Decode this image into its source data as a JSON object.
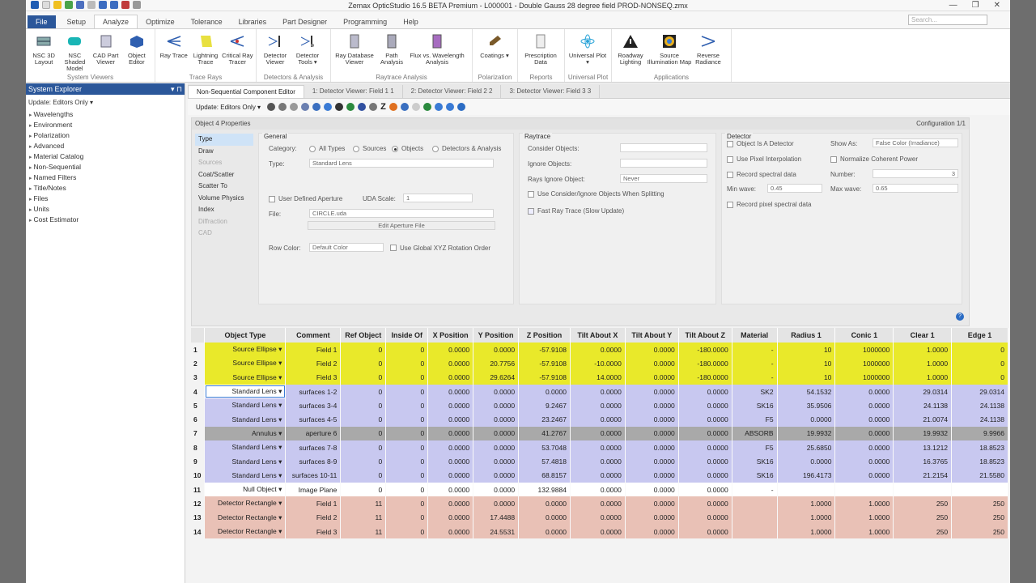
{
  "app": {
    "title": "Zemax OpticStudio 16.5  BETA  Premium  -  L000001  -  Double Gauss 28 degree field PROD-NONSEQ.zmx",
    "search_placeholder": "Search..."
  },
  "menu": [
    "File",
    "Setup",
    "Analyze",
    "Optimize",
    "Tolerance",
    "Libraries",
    "Part Designer",
    "Programming",
    "Help"
  ],
  "ribbon": {
    "groups": [
      {
        "label": "System Viewers",
        "buttons": [
          "NSC 3D Layout",
          "NSC Shaded Model",
          "CAD Part Viewer",
          "Object Editor"
        ]
      },
      {
        "label": "Trace Rays",
        "buttons": [
          "Ray Trace",
          "Lightning Trace",
          "Critical Ray Tracer"
        ]
      },
      {
        "label": "Detectors & Analysis",
        "buttons": [
          "Detector Viewer",
          "Detector Tools ▾"
        ]
      },
      {
        "label": "Raytrace Analysis",
        "buttons": [
          "Ray Database Viewer",
          "Path Analysis",
          "Flux vs. Wavelength Analysis"
        ]
      },
      {
        "label": "Polarization",
        "buttons": [
          "Coatings ▾"
        ]
      },
      {
        "label": "Reports",
        "buttons": [
          "Prescription Data"
        ]
      },
      {
        "label": "Universal Plot",
        "buttons": [
          "Universal Plot ▾"
        ]
      },
      {
        "label": "Applications",
        "buttons": [
          "Roadway Lighting",
          "Source Illumination Map",
          "Reverse Radiance"
        ]
      }
    ]
  },
  "system_explorer": {
    "title": "System Explorer",
    "update": "Update: Editors Only ▾",
    "items": [
      "Wavelengths",
      "Environment",
      "Polarization",
      "Advanced",
      "Material Catalog",
      "Non-Sequential",
      "Named Filters",
      "Title/Notes",
      "Files",
      "Units",
      "Cost Estimator"
    ]
  },
  "doc_tabs": [
    "Non-Sequential Component Editor",
    "1: Detector Viewer: Field 1 1",
    "2: Detector Viewer: Field 2 2",
    "3: Detector Viewer: Field 3 3"
  ],
  "toolbar": {
    "update": "Update: Editors Only ▾"
  },
  "props": {
    "header": "Object 4 Properties",
    "configuration": "Configuration 1/1",
    "nav": [
      "Type",
      "Draw",
      "Sources",
      "Coat/Scatter",
      "Scatter To",
      "Volume Physics",
      "Index",
      "Diffraction",
      "CAD"
    ],
    "general": {
      "title": "General",
      "category_label": "Category:",
      "category_options": [
        "All Types",
        "Sources",
        "Objects",
        "Detectors & Analysis"
      ],
      "type_label": "Type:",
      "type_value": "Standard Lens",
      "user_aperture": "User Defined Aperture",
      "uda_scale_label": "UDA Scale:",
      "uda_scale_value": "1",
      "file_label": "File:",
      "file_value": "CIRCLE.uda",
      "edit_aperture": "Edit Aperture File",
      "row_color_label": "Row Color:",
      "row_color_value": "Default Color",
      "global_xyz": "Use Global XYZ Rotation Order"
    },
    "raytrace": {
      "title": "Raytrace",
      "consider_label": "Consider Objects:",
      "ignore_label": "Ignore Objects:",
      "rays_ignore_label": "Rays Ignore Object:",
      "rays_ignore_value": "Never",
      "use_consider": "Use Consider/Ignore Objects When Splitting",
      "fast_ray": "Fast Ray Trace (Slow Update)"
    },
    "detector": {
      "title": "Detector",
      "is_detector": "Object Is A Detector",
      "show_as_label": "Show As:",
      "show_as_value": "False Color (Irradiance)",
      "pixel_interp": "Use Pixel Interpolation",
      "normalize": "Normalize Coherent Power",
      "record_spectral": "Record spectral data",
      "number_label": "Number:",
      "number_value": "3",
      "min_wave_label": "Min wave:",
      "min_wave_value": "0.45",
      "max_wave_label": "Max wave:",
      "max_wave_value": "0.65",
      "record_pixel": "Record pixel spectral data"
    }
  },
  "grid": {
    "columns": [
      "",
      "Object Type",
      "Comment",
      "Ref Object",
      "Inside Of",
      "X Position",
      "Y Position",
      "Z Position",
      "Tilt About X",
      "Tilt About Y",
      "Tilt About Z",
      "Material",
      "Radius 1",
      "Conic 1",
      "Clear 1",
      "Edge 1"
    ],
    "rows": [
      {
        "style": "yellow",
        "cells": [
          "1",
          "Source Ellipse ▾",
          "Field 1",
          "0",
          "0",
          "0.0000",
          "0.0000",
          "-57.9108",
          "0.0000",
          "0.0000",
          "-180.0000",
          "-",
          "10",
          "1000000",
          "1.0000",
          "0"
        ]
      },
      {
        "style": "yellow",
        "cells": [
          "2",
          "Source Ellipse ▾",
          "Field 2",
          "0",
          "0",
          "0.0000",
          "20.7756",
          "-57.9108",
          "-10.0000",
          "0.0000",
          "-180.0000",
          "-",
          "10",
          "1000000",
          "1.0000",
          "0"
        ]
      },
      {
        "style": "yellow",
        "cells": [
          "3",
          "Source Ellipse ▾",
          "Field 3",
          "0",
          "0",
          "0.0000",
          "29.6264",
          "-57.9108",
          "14.0000",
          "0.0000",
          "-180.0000",
          "-",
          "10",
          "1000000",
          "1.0000",
          "0"
        ]
      },
      {
        "style": "purple",
        "cells": [
          "4",
          "Standard Lens ▾",
          "surfaces 1-2",
          "0",
          "0",
          "0.0000",
          "0.0000",
          "0.0000",
          "0.0000",
          "0.0000",
          "0.0000",
          "SK2",
          "54.1532",
          "0.0000",
          "29.0314",
          "29.0314"
        ]
      },
      {
        "style": "purple",
        "cells": [
          "5",
          "Standard Lens ▾",
          "surfaces 3-4",
          "0",
          "0",
          "0.0000",
          "0.0000",
          "9.2467",
          "0.0000",
          "0.0000",
          "0.0000",
          "SK16",
          "35.9506",
          "0.0000",
          "24.1138",
          "24.1138"
        ]
      },
      {
        "style": "purple",
        "cells": [
          "6",
          "Standard Lens ▾",
          "surfaces 4-5",
          "0",
          "0",
          "0.0000",
          "0.0000",
          "23.2467",
          "0.0000",
          "0.0000",
          "0.0000",
          "F5",
          "0.0000",
          "0.0000",
          "21.0074",
          "24.1138"
        ]
      },
      {
        "style": "gray",
        "cells": [
          "7",
          "Annulus ▾",
          "aperture 6",
          "0",
          "0",
          "0.0000",
          "0.0000",
          "41.2767",
          "0.0000",
          "0.0000",
          "0.0000",
          "ABSORB",
          "19.9932",
          "0.0000",
          "19.9932",
          "9.9966"
        ]
      },
      {
        "style": "purple",
        "cells": [
          "8",
          "Standard Lens ▾",
          "surfaces 7-8",
          "0",
          "0",
          "0.0000",
          "0.0000",
          "53.7048",
          "0.0000",
          "0.0000",
          "0.0000",
          "F5",
          "25.6850",
          "0.0000",
          "13.1212",
          "18.8523"
        ]
      },
      {
        "style": "purple",
        "cells": [
          "9",
          "Standard Lens ▾",
          "surfaces 8-9",
          "0",
          "0",
          "0.0000",
          "0.0000",
          "57.4818",
          "0.0000",
          "0.0000",
          "0.0000",
          "SK16",
          "0.0000",
          "0.0000",
          "16.3765",
          "18.8523"
        ]
      },
      {
        "style": "purple",
        "cells": [
          "10",
          "Standard Lens ▾",
          "surfaces 10-11",
          "0",
          "0",
          "0.0000",
          "0.0000",
          "68.8157",
          "0.0000",
          "0.0000",
          "0.0000",
          "SK16",
          "196.4173",
          "0.0000",
          "21.2154",
          "21.5580"
        ]
      },
      {
        "style": "white",
        "cells": [
          "11",
          "Null Object ▾",
          "Image Plane",
          "0",
          "0",
          "0.0000",
          "0.0000",
          "132.9884",
          "0.0000",
          "0.0000",
          "0.0000",
          "-",
          "",
          "",
          "",
          ""
        ]
      },
      {
        "style": "salmon",
        "cells": [
          "12",
          "Detector Rectangle ▾",
          "Field 1",
          "11",
          "0",
          "0.0000",
          "0.0000",
          "0.0000",
          "0.0000",
          "0.0000",
          "0.0000",
          "",
          "1.0000",
          "1.0000",
          "250",
          "250"
        ]
      },
      {
        "style": "salmon",
        "cells": [
          "13",
          "Detector Rectangle ▾",
          "Field 2",
          "11",
          "0",
          "0.0000",
          "17.4488",
          "0.0000",
          "0.0000",
          "0.0000",
          "0.0000",
          "",
          "1.0000",
          "1.0000",
          "250",
          "250"
        ]
      },
      {
        "style": "salmon",
        "cells": [
          "14",
          "Detector Rectangle ▾",
          "Field 3",
          "11",
          "0",
          "0.0000",
          "24.5531",
          "0.0000",
          "0.0000",
          "0.0000",
          "0.0000",
          "",
          "1.0000",
          "1.0000",
          "250",
          "250"
        ]
      }
    ]
  },
  "colors": {
    "file_tab": "#2b579a",
    "row_yellow": "#e9e92a",
    "row_purple": "#c8c8f0",
    "row_gray": "#a9a9a9",
    "row_salmon": "#e9c1b6"
  }
}
